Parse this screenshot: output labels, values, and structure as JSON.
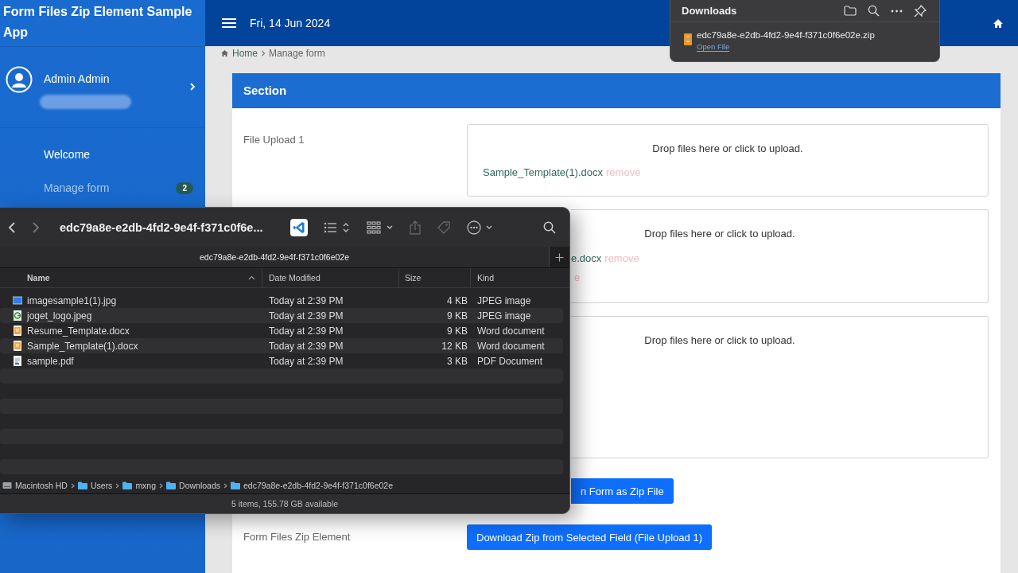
{
  "sidebar": {
    "app_title": "Form Files Zip Element Sample App",
    "user": {
      "name": "Admin Admin"
    },
    "menu": [
      {
        "label": "Welcome",
        "current": false
      },
      {
        "label": "Manage form",
        "current": true,
        "badge": "2"
      }
    ]
  },
  "header": {
    "date": "Fri, 14 Jun 2024"
  },
  "breadcrumb": [
    "Home",
    "Manage form"
  ],
  "section": {
    "title": "Section",
    "fields": [
      {
        "kind": "upload",
        "label": "File Upload 1",
        "hint": "Drop files here or click to upload.",
        "files": [
          {
            "name": "Sample_Template(1).docx",
            "remove": "remove"
          }
        ]
      },
      {
        "kind": "upload",
        "hint": "Drop files here or click to upload.",
        "files": [
          {
            "name": "e.docx",
            "remove": "remove"
          },
          {
            "remove": "e"
          }
        ],
        "covered": true
      },
      {
        "kind": "upload",
        "hint": "Drop files here or click to upload.",
        "covered": true
      },
      {
        "kind": "button",
        "button": "n Form as Zip File",
        "covered": true
      },
      {
        "kind": "button",
        "label": "Form Files Zip Element",
        "button": "Download Zip from Selected Field (File Upload 1)"
      }
    ]
  },
  "downloads_popup": {
    "title": "Downloads",
    "items": [
      {
        "file": "edc79a8e-e2db-4fd2-9e4f-f371c0f6e02e.zip",
        "action": "Open File"
      }
    ]
  },
  "finder": {
    "title": "edc79a8e-e2db-4fd2-9e4f-f371c0f6e...",
    "tab": "edc79a8e-e2db-4fd2-9e4f-f371c0f6e02e",
    "columns": [
      "Name",
      "Date Modified",
      "Size",
      "Kind"
    ],
    "rows": [
      {
        "kind": "picture",
        "name": "imagesample1(1).jpg",
        "date": "Today at 2:39 PM",
        "size": "4 KB",
        "file_kind": "JPEG image"
      },
      {
        "kind": "photo",
        "name": "joget_logo.jpeg",
        "date": "Today at 2:39 PM",
        "size": "9 KB",
        "file_kind": "JPEG image"
      },
      {
        "kind": "word",
        "name": "Resume_Template.docx",
        "date": "Today at 2:39 PM",
        "size": "9 KB",
        "file_kind": "Word document"
      },
      {
        "kind": "word",
        "name": "Sample_Template(1).docx",
        "date": "Today at 2:39 PM",
        "size": "12 KB",
        "file_kind": "Word document"
      },
      {
        "kind": "pdf",
        "name": "sample.pdf",
        "date": "Today at 2:39 PM",
        "size": "3 KB",
        "file_kind": "PDF Document"
      }
    ],
    "path": [
      {
        "kind": "disk",
        "label": "Macintosh HD"
      },
      {
        "kind": "folder",
        "label": "Users"
      },
      {
        "kind": "folder",
        "label": "mxng"
      },
      {
        "kind": "folder",
        "label": "Downloads"
      },
      {
        "kind": "folder",
        "label": "edc79a8e-e2db-4fd2-9e4f-f371c0f6e02e"
      }
    ],
    "status": "5 items, 155.78 GB available"
  }
}
